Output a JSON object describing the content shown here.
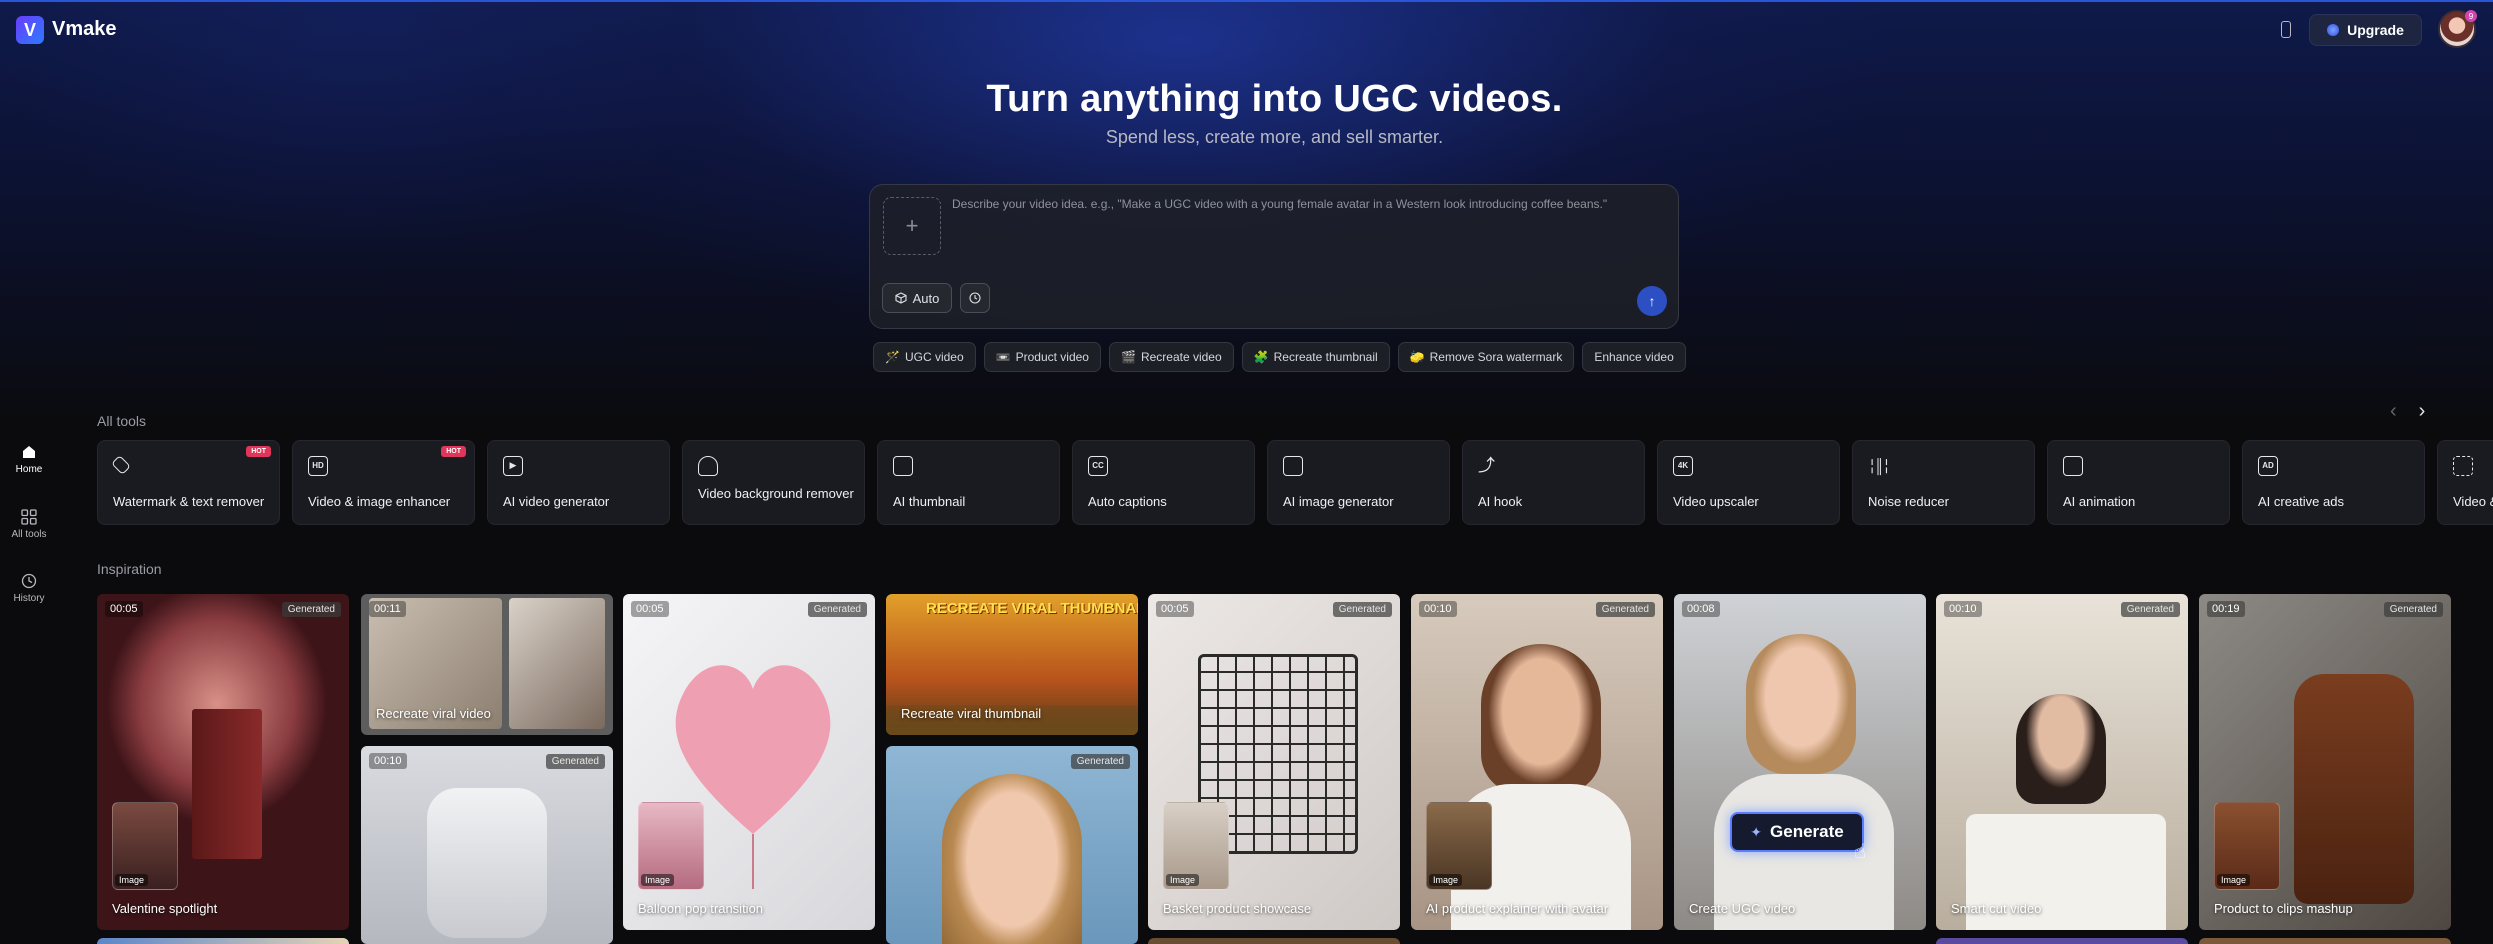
{
  "app": {
    "name": "Vmake",
    "logo_letter": "V"
  },
  "header": {
    "upgrade_label": "Upgrade",
    "avatar_badge": "9"
  },
  "sidebar": {
    "items": [
      {
        "label": "Home",
        "icon": "home-icon",
        "active": true
      },
      {
        "label": "All tools",
        "icon": "grid-icon",
        "active": false
      },
      {
        "label": "History",
        "icon": "clock-icon",
        "active": false
      }
    ]
  },
  "hero": {
    "title": "Turn anything into UGC videos.",
    "subtitle": "Spend less, create more, and sell smarter."
  },
  "prompt": {
    "add_symbol": "+",
    "placeholder": "Describe your video idea. e.g., \"Make a UGC video with a young female avatar in a Western look introducing coffee beans.\"",
    "mode_label": "Auto"
  },
  "quick_chips": [
    {
      "emoji": "🪄",
      "label": "UGC video"
    },
    {
      "emoji": "📼",
      "label": "Product video"
    },
    {
      "emoji": "🎬",
      "label": "Recreate video"
    },
    {
      "emoji": "🧩",
      "label": "Recreate thumbnail"
    },
    {
      "emoji": "🧽",
      "label": "Remove Sora watermark"
    },
    {
      "emoji": "",
      "label": "Enhance video"
    }
  ],
  "all_tools": {
    "title": "All tools",
    "items": [
      {
        "label": "Watermark & text remover",
        "badge": "HOT",
        "icon": "eraser-icon"
      },
      {
        "label": "Video & image enhancer",
        "badge": "HOT",
        "icon": "hd-icon"
      },
      {
        "label": "AI video generator",
        "badge": "",
        "icon": "play-icon"
      },
      {
        "label": "Video background remover",
        "badge": "",
        "icon": "person-cutout-icon"
      },
      {
        "label": "AI thumbnail",
        "badge": "",
        "icon": "thumbnail-icon"
      },
      {
        "label": "Auto captions",
        "badge": "",
        "icon": "captions-icon"
      },
      {
        "label": "AI image generator",
        "badge": "",
        "icon": "image-icon"
      },
      {
        "label": "AI hook",
        "badge": "",
        "icon": "hook-icon"
      },
      {
        "label": "Video upscaler",
        "badge": "",
        "icon": "4k-icon"
      },
      {
        "label": "Noise reducer",
        "badge": "",
        "icon": "waveform-icon"
      },
      {
        "label": "AI animation",
        "badge": "",
        "icon": "clapper-icon"
      },
      {
        "label": "AI creative ads",
        "badge": "",
        "icon": "ad-icon"
      },
      {
        "label": "Video &",
        "badge": "",
        "icon": "scan-icon"
      }
    ]
  },
  "inspiration": {
    "title": "Inspiration",
    "generated_label": "Generated",
    "image_label": "Image",
    "generate_button": "Generate",
    "cards": [
      {
        "duration": "00:05",
        "title": "Valentine spotlight",
        "generated": true,
        "has_image": true
      },
      {
        "duration": "00:11",
        "title": "Recreate viral video",
        "generated": false,
        "has_image": false
      },
      {
        "duration": "00:10",
        "title": "",
        "generated": true,
        "has_image": false
      },
      {
        "duration": "00:05",
        "title": "Balloon pop transition",
        "generated": true,
        "has_image": true
      },
      {
        "duration": "",
        "title": "Recreate viral thumbnail",
        "generated": false,
        "has_image": false,
        "banner": "RECREATE VIRAL THUMBNAIL"
      },
      {
        "duration": "",
        "title": "",
        "generated": true,
        "has_image": false
      },
      {
        "duration": "00:05",
        "title": "Basket product showcase",
        "generated": true,
        "has_image": true
      },
      {
        "duration": "00:10",
        "title": "AI product explainer with avatar",
        "generated": true,
        "has_image": true
      },
      {
        "duration": "00:08",
        "title": "Create UGC video",
        "generated": false,
        "has_image": false
      },
      {
        "duration": "00:10",
        "title": "Smart cut video",
        "generated": true,
        "has_image": false
      },
      {
        "duration": "00:19",
        "title": "Product to clips mashup",
        "generated": true,
        "has_image": true
      }
    ]
  }
}
